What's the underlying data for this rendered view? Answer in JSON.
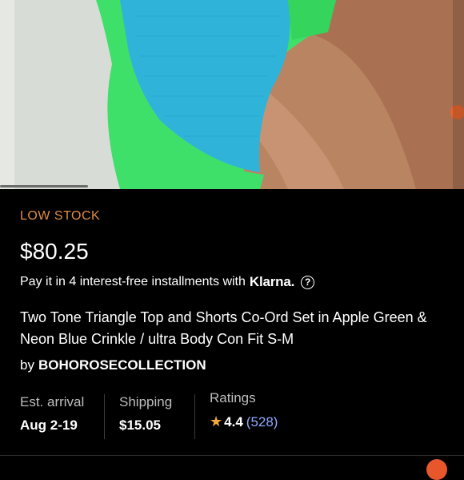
{
  "listing": {
    "stock_status": "LOW STOCK",
    "price": "$80.25",
    "installments_text": "Pay it in 4 interest-free installments with",
    "installments_brand": "Klarna.",
    "title": "Two Tone Triangle Top and Shorts Co-Ord Set in Apple Green & Neon Blue Crinkle / ultra Body Con Fit S-M",
    "seller_prefix": "by",
    "seller_name": "BOHOROSECOLLECTION"
  },
  "details": {
    "arrival_label": "Est. arrival",
    "arrival_value": "Aug 2-19",
    "shipping_label": "Shipping",
    "shipping_value": "$15.05",
    "ratings_label": "Ratings",
    "rating_value": "4.4",
    "rating_count": "(528)"
  },
  "colors": {
    "stock_status": "#e08b43",
    "star": "#f2a93b",
    "rating_count": "#8fa8ff",
    "background": "#000000"
  },
  "icons": {
    "help": "question-circle-icon",
    "star": "star-icon"
  }
}
